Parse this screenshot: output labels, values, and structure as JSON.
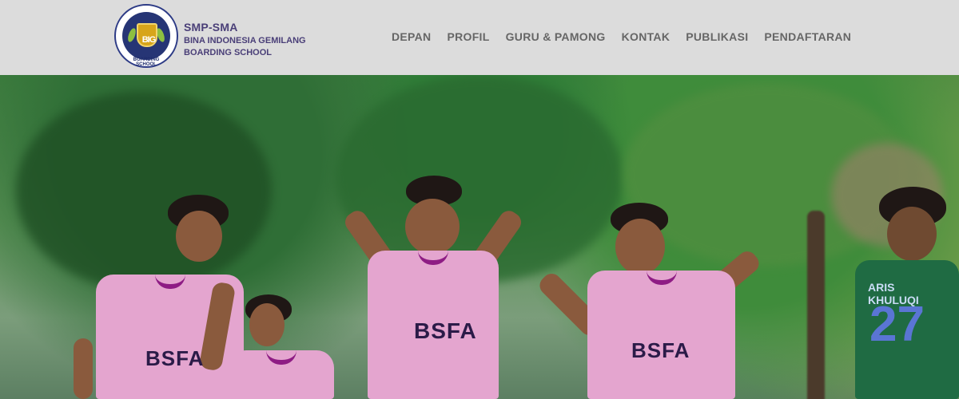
{
  "header": {
    "brand_title": "SMP-SMA",
    "brand_subtitle_1": "BINA INDONESIA GEMILANG",
    "brand_subtitle_2": "BOARDING SCHOOL",
    "logo_text": "BIG",
    "logo_ring_text": "BOARDING SCHOOL",
    "logo_top_text": "BINA INDONESIA GEMILANG"
  },
  "nav": {
    "items": [
      {
        "label": "DEPAN"
      },
      {
        "label": "PROFIL"
      },
      {
        "label": "GURU & PAMONG"
      },
      {
        "label": "KONTAK"
      },
      {
        "label": "PUBLIKASI"
      },
      {
        "label": "PENDAFTARAN"
      }
    ]
  },
  "hero": {
    "shirt_text_1": "BSFA",
    "shirt_text_2": "BSFA",
    "shirt_text_3": "BSFA",
    "green_name": "ARIS KHULUQI",
    "green_number": "27"
  },
  "colors": {
    "header_bg": "#dcdcdc",
    "brand": "#4a3f78",
    "nav": "#666666",
    "jersey": "#e4a5cf"
  }
}
